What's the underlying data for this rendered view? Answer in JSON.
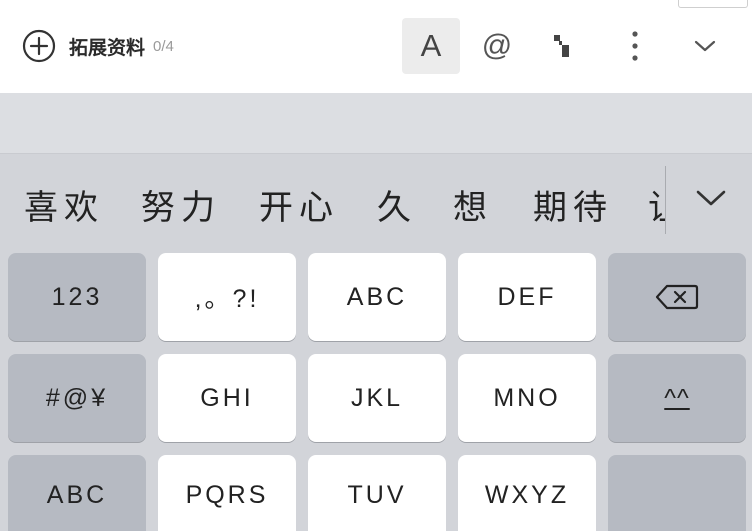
{
  "toolbar": {
    "ext_label": "拓展资料",
    "ext_count": "0/4",
    "font_label": "A",
    "at_label": "@",
    "icons": [
      "plus-circle-icon",
      "cursor-move-icon",
      "more-vertical-icon",
      "chevron-down-icon"
    ]
  },
  "candidates": {
    "items": [
      "喜欢",
      "努力",
      "开心",
      "久",
      "想",
      "期待",
      "让"
    ]
  },
  "keyboard": {
    "rows": [
      [
        "123",
        ",。?!",
        "ABC",
        "DEF",
        ""
      ],
      [
        "#@¥",
        "GHI",
        "JKL",
        "MNO",
        "^^"
      ],
      [
        "ABC",
        "PQRS",
        "TUV",
        "WXYZ",
        ""
      ]
    ],
    "colors": {
      "light_key": "#ffffff",
      "dark_key": "#b6bac2",
      "background": "#d2d4d9"
    }
  }
}
